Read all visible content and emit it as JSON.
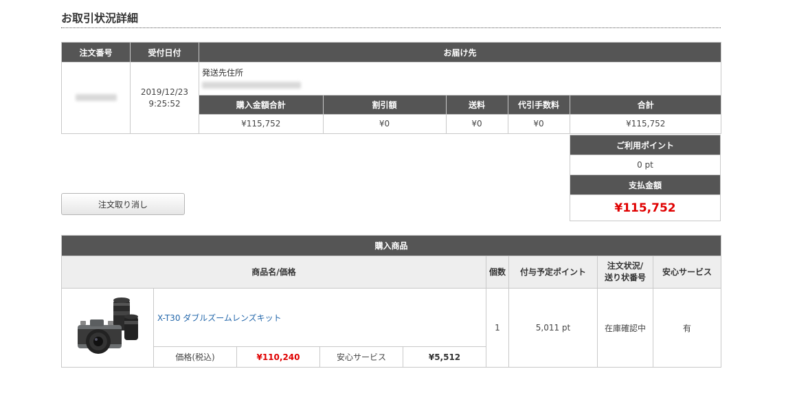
{
  "page": {
    "title": "お取引状況詳細"
  },
  "order": {
    "headers": {
      "order_no": "注文番号",
      "date": "受付日付",
      "ship_to": "お届け先"
    },
    "date": "2019/12/23",
    "time": "9:25:52",
    "address_label": "発送先住所",
    "amount_headers": [
      "購入金額合計",
      "割引額",
      "送料",
      "代引手数料",
      "合計"
    ],
    "amounts": [
      "¥115,752",
      "¥0",
      "¥0",
      "¥0",
      "¥115,752"
    ]
  },
  "payment": {
    "points_label": "ご利用ポイント",
    "points_value": "0 pt",
    "pay_label": "支払金額",
    "pay_value": "¥115,752"
  },
  "actions": {
    "cancel_label": "注文取り消し"
  },
  "products": {
    "section_title": "購入商品",
    "col_name": "商品名/価格",
    "col_qty": "個数",
    "col_points": "付与予定ポイント",
    "col_status_1": "注文状況/",
    "col_status_2": "送り状番号",
    "col_service": "安心サービス",
    "items": [
      {
        "name": "X-T30 ダブルズームレンズキット",
        "price_label": "価格(税込)",
        "price": "¥110,240",
        "service_label": "安心サービス",
        "service_price": "¥5,512",
        "qty": "1",
        "points": "5,011 pt",
        "status": "在庫確認中",
        "service": "有"
      }
    ]
  },
  "colors": {
    "header_bg": "#555555",
    "accent_red": "#e00000",
    "link_blue": "#2266aa"
  }
}
